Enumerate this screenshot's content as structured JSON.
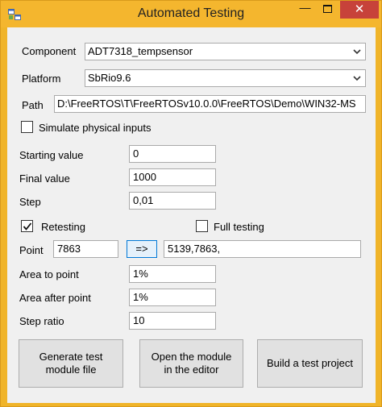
{
  "window": {
    "title": "Automated Testing",
    "minimize_glyph": "—",
    "close_glyph": "✕"
  },
  "form": {
    "component_label": "Component",
    "component_value": "ADT7318_tempsensor",
    "platform_label": "Platform",
    "platform_value": "SbRio9.6",
    "path_label": "Path",
    "path_value": "D:\\FreeRTOS\\T\\FreeRTOSv10.0.0\\FreeRTOS\\Demo\\WIN32-MS",
    "simulate_label": "Simulate physical inputs",
    "simulate_checked": false,
    "starting_value_label": "Starting value",
    "starting_value": "0",
    "final_value_label": "Final value",
    "final_value": "1000",
    "step_label": "Step",
    "step_value": "0,01",
    "retesting_label": "Retesting",
    "retesting_checked": true,
    "full_testing_label": "Full testing",
    "full_testing_checked": false,
    "point_label": "Point",
    "point_value": "7863",
    "arrow_button_label": "=>",
    "points_list_value": "5139,7863,",
    "area_to_point_label": "Area to point",
    "area_to_point_value": "1%",
    "area_after_point_label": "Area after point",
    "area_after_point_value": "1%",
    "step_ratio_label": "Step ratio",
    "step_ratio_value": "10"
  },
  "actions": {
    "generate_label": "Generate test module file",
    "open_label": "Open the module in the editor",
    "build_label": "Build a test project"
  },
  "colors": {
    "title_bar": "#f4b62e",
    "close_button": "#c7423a",
    "client_bg": "#f0f0f0",
    "accent_blue": "#0078d7"
  },
  "icons": {
    "app": "app-window-icon",
    "dropdown": "chevron-down-icon",
    "check": "check-icon"
  }
}
